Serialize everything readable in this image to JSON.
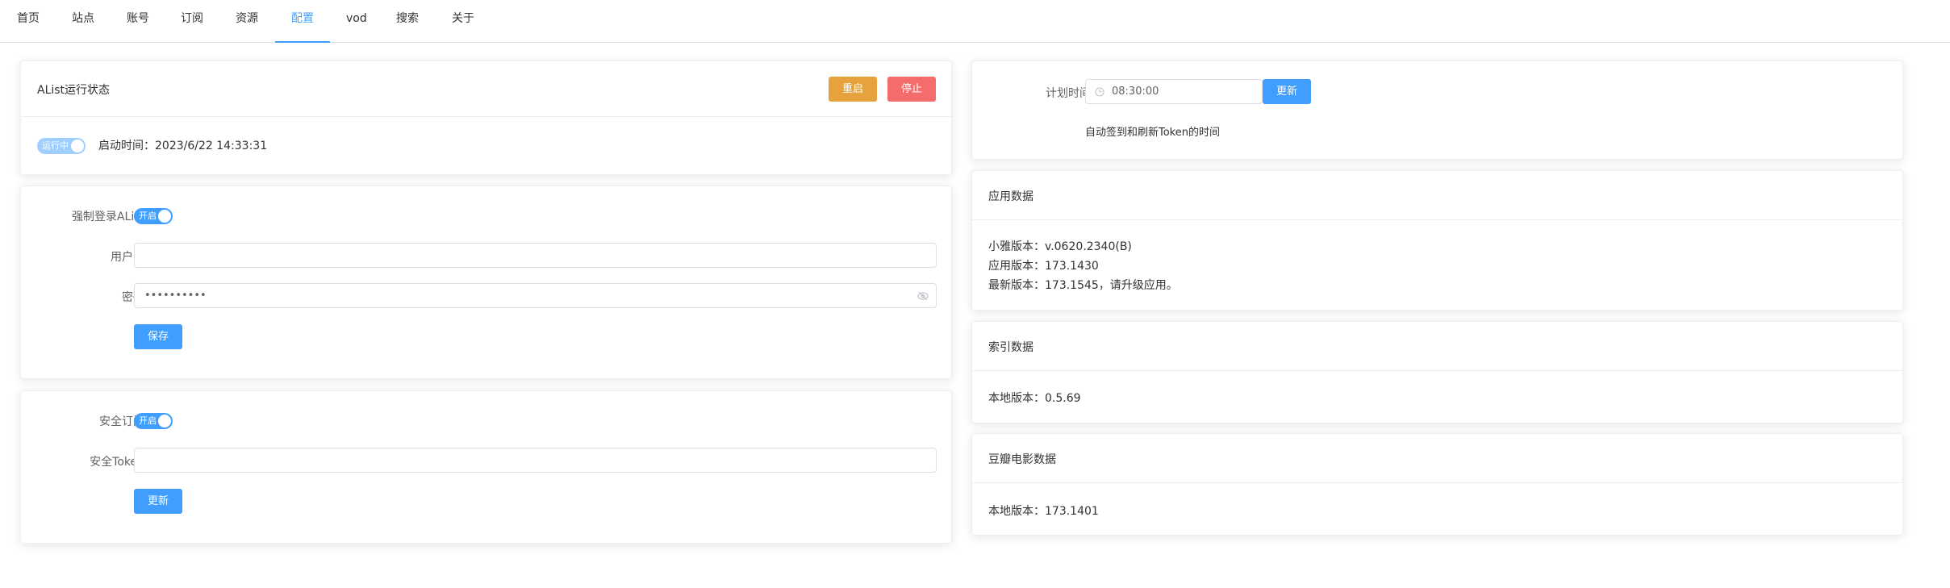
{
  "nav": {
    "items": [
      {
        "label": "首页"
      },
      {
        "label": "站点"
      },
      {
        "label": "账号"
      },
      {
        "label": "订阅"
      },
      {
        "label": "资源"
      },
      {
        "label": "配置"
      },
      {
        "label": "vod"
      },
      {
        "label": "搜索"
      },
      {
        "label": "关于"
      }
    ],
    "active": "配置"
  },
  "alist_status": {
    "title": "AList运行状态",
    "restart_label": "重启",
    "stop_label": "停止",
    "switch_label": "运行中",
    "start_time": "启动时间：2023/6/22 14:33:31"
  },
  "login": {
    "force_login_label": "强制登录AList",
    "force_login_switch": "开启",
    "username_label": "用户名",
    "username_value": "",
    "password_label": "密码",
    "password_value": "••••••••••",
    "save_label": "保存"
  },
  "security": {
    "subscribe_label": "安全订阅",
    "subscribe_switch": "开启",
    "token_label": "安全Token",
    "token_value": "",
    "update_label": "更新"
  },
  "schedule": {
    "label": "计划时间",
    "time_value": "08:30:00",
    "update_label": "更新",
    "hint": "自动签到和刷新Token的时间"
  },
  "app_data": {
    "title": "应用数据",
    "lines": [
      "小雅版本：v.0620.2340(B)",
      "应用版本：173.1430",
      "最新版本：173.1545，请升级应用。"
    ]
  },
  "index_data": {
    "title": "索引数据",
    "line": "本地版本：0.5.69"
  },
  "douban_data": {
    "title": "豆瓣电影数据",
    "line": "本地版本：173.1401"
  },
  "colors": {
    "primary": "#409eff",
    "warning": "#e6a23c",
    "danger": "#f56c6c"
  }
}
